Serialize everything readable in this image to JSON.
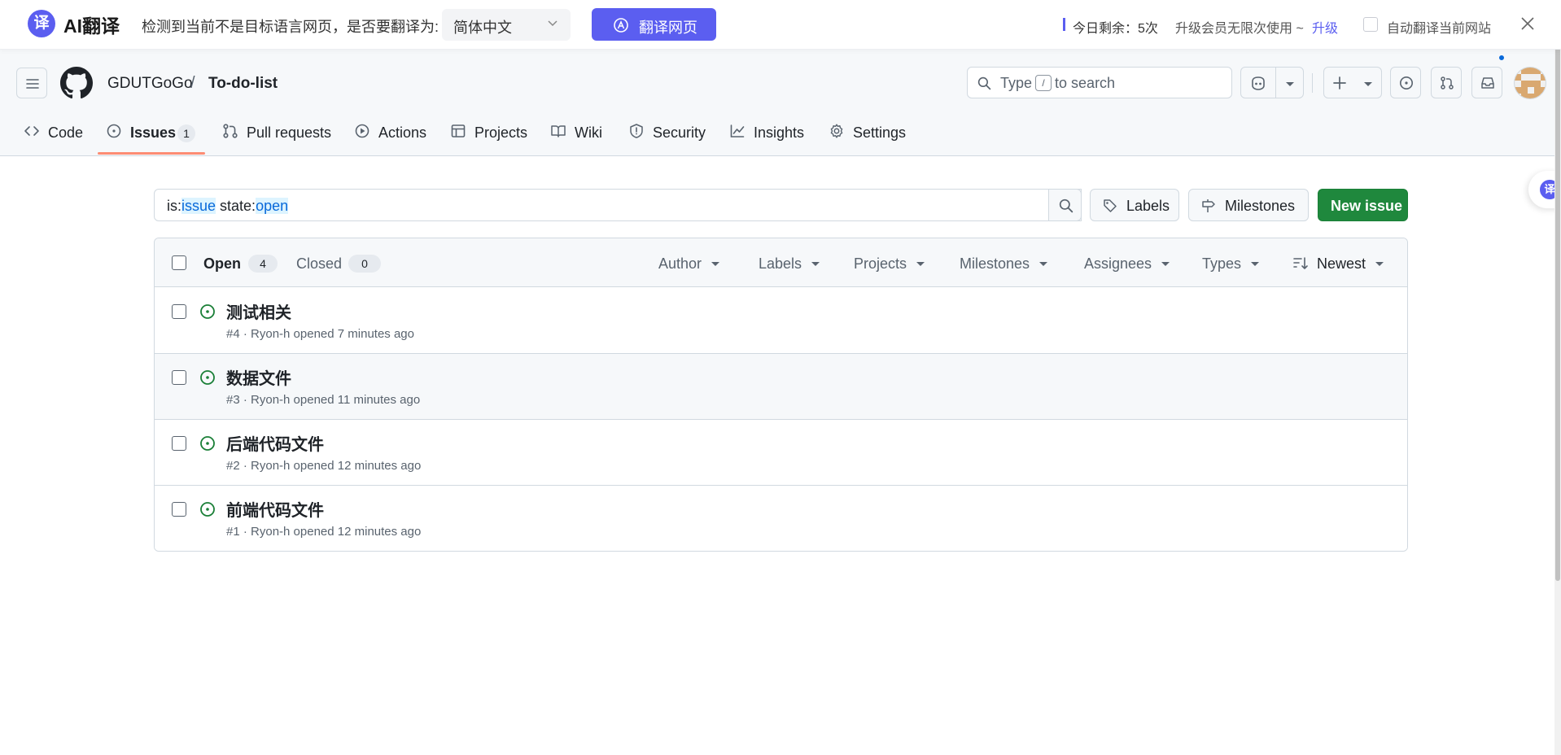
{
  "translate_bar": {
    "logo_glyph": "译",
    "brand": "AI翻译",
    "message": "检测到当前不是目标语言网页，是否要翻译为:",
    "language": "简体中文",
    "translate_button": "翻译网页",
    "remaining": "今日剩余：5次",
    "upgrade_text": "升级会员无限次使用 ~",
    "upgrade_link": "升级",
    "auto_translate": "自动翻译当前网站",
    "accent": "#5b5ef0"
  },
  "header": {
    "owner": "GDUTGoGo",
    "separator": "/",
    "repo": "To-do-list",
    "search": {
      "before": "Type",
      "key": "/",
      "after": "to search"
    }
  },
  "tabs": [
    {
      "label": "Code",
      "icon": "code-icon"
    },
    {
      "label": "Issues",
      "icon": "issue-opened-icon",
      "count": "1",
      "active": true
    },
    {
      "label": "Pull requests",
      "icon": "pull-request-icon"
    },
    {
      "label": "Actions",
      "icon": "play-icon"
    },
    {
      "label": "Projects",
      "icon": "table-icon"
    },
    {
      "label": "Wiki",
      "icon": "book-icon"
    },
    {
      "label": "Security",
      "icon": "shield-icon"
    },
    {
      "label": "Insights",
      "icon": "graph-icon"
    },
    {
      "label": "Settings",
      "icon": "gear-icon"
    }
  ],
  "filter": {
    "q1": "is:",
    "q2": "issue",
    "q3": " state:",
    "q4": "open"
  },
  "buttons": {
    "labels": "Labels",
    "milestones": "Milestones",
    "new_issue": "New issue"
  },
  "issues_header": {
    "open_label": "Open",
    "open_count": "4",
    "closed_label": "Closed",
    "closed_count": "0",
    "filters": [
      "Author",
      "Labels",
      "Projects",
      "Milestones",
      "Assignees",
      "Types"
    ],
    "sort": "Newest"
  },
  "issues": [
    {
      "title": "测试相关",
      "meta": "#4 · Ryon-h opened 7 minutes ago"
    },
    {
      "title": "数据文件",
      "meta": "#3 · Ryon-h opened 11 minutes ago"
    },
    {
      "title": "后端代码文件",
      "meta": "#2 · Ryon-h opened 12 minutes ago"
    },
    {
      "title": "前端代码文件",
      "meta": "#1 · Ryon-h opened 12 minutes ago"
    }
  ],
  "floating_button_glyph": "译",
  "colors": {
    "open_green": "#1a7f37",
    "primary_green": "#1f883d",
    "tab_underline": "#fd8c73",
    "link_blue": "#0969da"
  }
}
